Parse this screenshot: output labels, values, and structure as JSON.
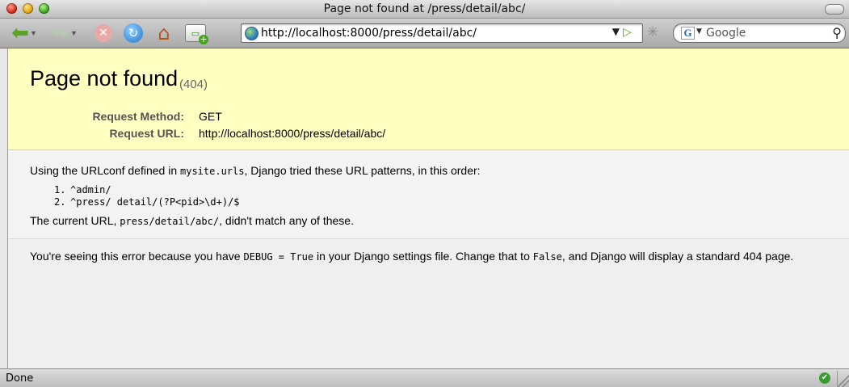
{
  "window": {
    "title": "Page not found at /press/detail/abc/"
  },
  "toolbar": {
    "back_icon": "back-arrow-icon",
    "forward_icon": "forward-arrow-icon",
    "stop_icon": "stop-icon",
    "reload_icon": "reload-icon",
    "home_icon": "home-icon",
    "new_tab_icon": "new-tab-icon",
    "url": "http://localhost:8000/press/detail/abc/",
    "search_placeholder": "Google",
    "search_engine_icon": "google-icon"
  },
  "page": {
    "title": "Page not found",
    "status_code": "(404)",
    "request_method_label": "Request Method:",
    "request_method_value": "GET",
    "request_url_label": "Request URL:",
    "request_url_value": "http://localhost:8000/press/detail/abc/",
    "info": {
      "prefix": "Using the URLconf defined in ",
      "urlconf": "mysite.urls",
      "suffix": ", Django tried these URL patterns, in this order:",
      "patterns": [
        {
          "num": "1.",
          "pattern": "^admin/"
        },
        {
          "num": "2.",
          "pattern": "^press/ detail/(?P<pid>\\d+)/$"
        }
      ],
      "current_prefix": "The current URL, ",
      "current_url": "press/detail/abc/",
      "current_suffix": ", didn't match any of these."
    },
    "explanation": {
      "part1": "You're seeing this error because you have ",
      "code1": "DEBUG = True",
      "part2": " in your Django settings file. Change that to ",
      "code2": "False",
      "part3": ", and Django will display a standard 404 page."
    }
  },
  "statusbar": {
    "text": "Done",
    "security_icon": "check-circle-icon"
  },
  "colors": {
    "summary_bg": "#ffffc2",
    "label_gray": "#555555"
  }
}
